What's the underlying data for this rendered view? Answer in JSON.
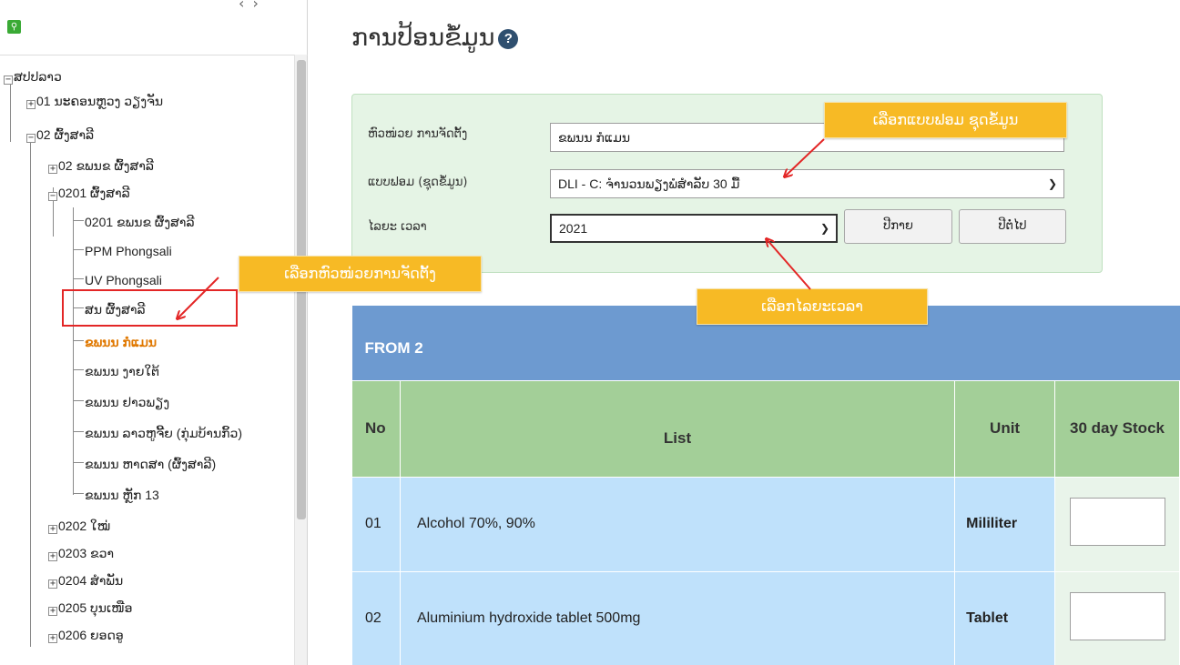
{
  "left_panel": {
    "tree": [
      {
        "label": "ສປປລາວ",
        "expander": "−"
      },
      {
        "label": "01 ນະຄອນຫຼວງ ວຽງຈັນ",
        "expander": "+"
      },
      {
        "label": "02 ຜົ້ງສາລີ",
        "expander": "−"
      },
      {
        "label": "02 ຂພນຂ ຜົ້ງສາລີ",
        "expander": "+"
      },
      {
        "label": "0201 ຜົ້ງສາລີ",
        "expander": "−"
      },
      {
        "label": "0201 ຂພນຂ ຜົ້ງສາລີ"
      },
      {
        "label": "PPM Phongsali"
      },
      {
        "label": "UV Phongsali"
      },
      {
        "label": "ສນ ຜົ້ງສາລີ"
      },
      {
        "label": "ຂພນນ ກໍແມນ"
      },
      {
        "label": "ຂພນນ ງາຍໃຕ້"
      },
      {
        "label": "ຂພນນ ຢາວພຽງ"
      },
      {
        "label": "ຂພນນ ລາວຫູຈີ້ຍ (ກຸ່ມບ້ານກິ້ວ)"
      },
      {
        "label": "ຂພນນ ຫາດສາ (ຜົ້ງສາລີ)"
      },
      {
        "label": "ຂພນນ ຫຼັກ 13"
      },
      {
        "label": "0202 ໃໝ່",
        "expander": "+"
      },
      {
        "label": "0203 ຂວາ",
        "expander": "+"
      },
      {
        "label": "0204 ສໍາພັນ",
        "expander": "+"
      },
      {
        "label": "0205 ບຸນເໜືອ",
        "expander": "+"
      },
      {
        "label": "0206 ຍອດອູ",
        "expander": "+"
      }
    ],
    "top_arrows": "‹ ›"
  },
  "header": {
    "title": "ການປ້ອນຂໍ້ມູນ",
    "help_icon": "?"
  },
  "form": {
    "unit_label": "ຫົວໜ່ວຍ ການຈັດຕັ້ງ",
    "unit_value": "ຂພນນ ກໍແມນ",
    "template_label": "ແບບຟອມ (ຊຸດຂໍ້ມູນ)",
    "template_value": "DLI - C: ຈໍານວນພຽງພໍສໍາລັບ 30 ມື້",
    "period_label": "ໄລຍະ ເວລາ",
    "period_value": "2021",
    "prev_button": "ປີກາຍ",
    "next_button": "ປີຕໍ່ໄປ"
  },
  "table": {
    "form_title": "FROM 2",
    "columns": [
      "No",
      "List",
      "Unit",
      "30 day Stock"
    ],
    "rows": [
      {
        "no": "01",
        "list": "Alcohol 70%, 90%",
        "unit": "Mililiter"
      },
      {
        "no": "02",
        "list": "Aluminium hydroxide tablet 500mg",
        "unit": "Tablet"
      }
    ]
  },
  "callouts": {
    "select_template": "ເລືອກແບບຟອມ ຊຸດຂໍ້ມູນ",
    "select_unit": "ເລືອກຫົວໜ່ວຍການຈັດຕັ້ງ",
    "select_period": "ເລືອກໄລຍະເວລາ"
  },
  "colors": {
    "callout_bg": "#f7ba25",
    "highlight_border": "#e32626",
    "arrow": "#e32626",
    "filter_bg": "#e5f4e5",
    "table_header": "#6d9ad0",
    "column_header": "#a3cf98",
    "row_bg": "#bfe1fb",
    "selected_tree_item": "#e07800"
  }
}
